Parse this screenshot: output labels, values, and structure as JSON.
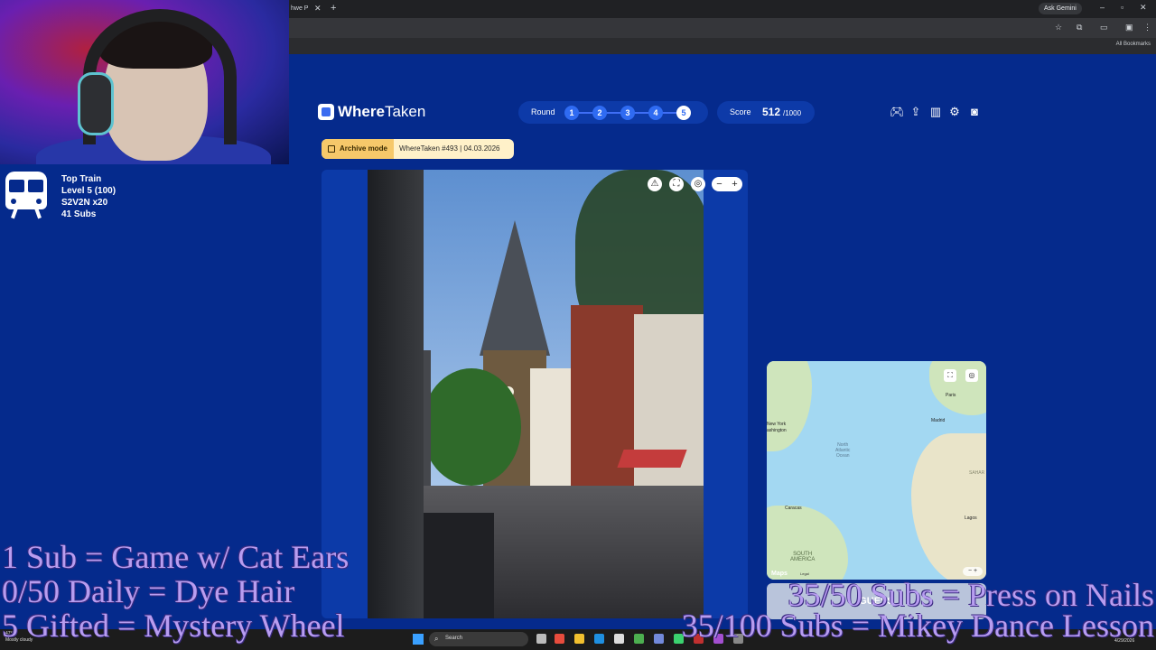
{
  "browser": {
    "tab_title": "hwe P",
    "ask_gemini": "Ask Gemini",
    "bookmarks_label": "All Bookmarks"
  },
  "stream": {
    "train_title": "Top Train",
    "train_level": "Level 5  (100)",
    "train_code": "S2V2N x20",
    "subs": "41 Subs"
  },
  "app": {
    "logo_bold": "Where",
    "logo_light": "Taken",
    "round_label": "Round",
    "rounds": [
      "1",
      "2",
      "3",
      "4",
      "5"
    ],
    "current_round": "5",
    "score_label": "Score",
    "score_value": "512",
    "score_max": "/1000",
    "archive_badge": "Archive mode",
    "archive_info": "WhereTaken #493 | 04.03.2026",
    "toolbar_icons": [
      "gamepad-icon",
      "share-icon",
      "stats-icon",
      "settings-icon",
      "profile-icon"
    ]
  },
  "map": {
    "labels": {
      "paris": "Paris",
      "madrid": "Madrid",
      "new_york": "New York",
      "washington": "ashington",
      "caracas": "Caracas",
      "lagos": "Lagos",
      "sahara": "SAHAR",
      "north_atlantic": "North\nAtlantic\nOcean",
      "south_america": "SOUTH\nAMERICA"
    },
    "logo": "Maps",
    "legal": "Legal",
    "zoom": "− +",
    "guess_button": "GUESS"
  },
  "taskbar": {
    "weather_temp": "47°F",
    "weather_desc": "Mostly cloudy",
    "search": "Search",
    "date": "4/29/2026"
  },
  "overlay": {
    "goal1": "1 Sub = Game w/ Cat Ears",
    "goal2": "0/50 Daily = Dye Hair",
    "goal3": "5 Gifted = Mystery Wheel",
    "goal4": "35/50 Subs = Press on Nails",
    "goal5": "35/100 Subs = Mikey Dance Lesson"
  },
  "colors": {
    "background": "#052a8c",
    "accent": "#2f6bf2",
    "overlay_text": "#b89df0",
    "archive_badge": "#f6c86a"
  }
}
